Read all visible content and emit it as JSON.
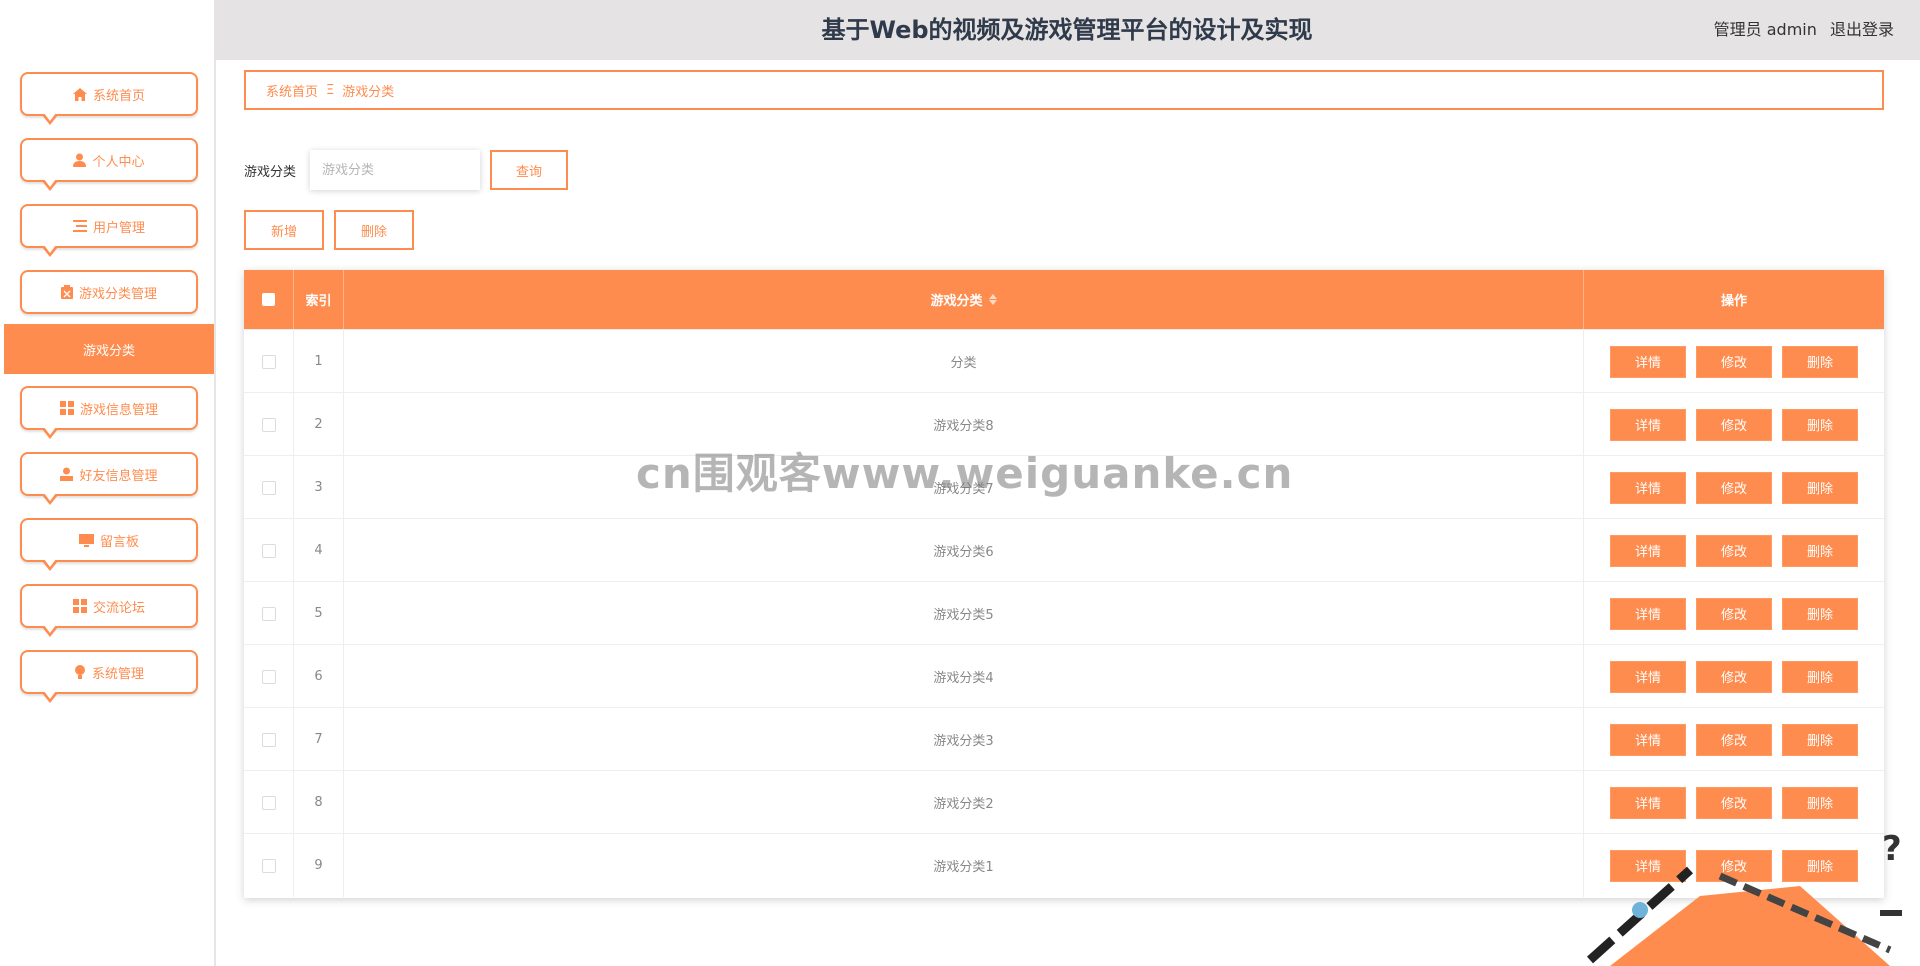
{
  "header": {
    "title": "基于Web的视频及游戏管理平台的设计及实现",
    "user_label": "管理员 admin",
    "logout_label": "退出登录"
  },
  "sidebar": {
    "items": [
      {
        "label": "系统首页",
        "icon": "home-icon"
      },
      {
        "label": "个人中心",
        "icon": "person-icon"
      },
      {
        "label": "用户管理",
        "icon": "list-icon"
      },
      {
        "label": "游戏分类管理",
        "icon": "clipboard-icon"
      },
      {
        "label": "游戏信息管理",
        "icon": "grid-icon"
      },
      {
        "label": "好友信息管理",
        "icon": "user-icon"
      },
      {
        "label": "留言板",
        "icon": "monitor-icon"
      },
      {
        "label": "交流论坛",
        "icon": "grid-icon"
      },
      {
        "label": "系统管理",
        "icon": "bulb-icon"
      }
    ],
    "active_submenu": "游戏分类"
  },
  "breadcrumb": {
    "home": "系统首页",
    "separator": "Ξ",
    "current": "游戏分类"
  },
  "search": {
    "label": "游戏分类",
    "placeholder": "游戏分类",
    "query_button": "查询"
  },
  "actions": {
    "add": "新增",
    "delete": "删除"
  },
  "table": {
    "columns": [
      "索引",
      "游戏分类",
      "操作"
    ],
    "row_actions": [
      "详情",
      "修改",
      "删除"
    ],
    "rows": [
      {
        "index": "1",
        "name": "分类"
      },
      {
        "index": "2",
        "name": "游戏分类8"
      },
      {
        "index": "3",
        "name": "游戏分类7"
      },
      {
        "index": "4",
        "name": "游戏分类6"
      },
      {
        "index": "5",
        "name": "游戏分类5"
      },
      {
        "index": "6",
        "name": "游戏分类4"
      },
      {
        "index": "7",
        "name": "游戏分类3"
      },
      {
        "index": "8",
        "name": "游戏分类2"
      },
      {
        "index": "9",
        "name": "游戏分类1"
      }
    ]
  },
  "watermark": "cn围观客www.weiguanke.cn",
  "colors": {
    "accent": "#ff8c4f",
    "header_bg": "#e5e3e4"
  }
}
